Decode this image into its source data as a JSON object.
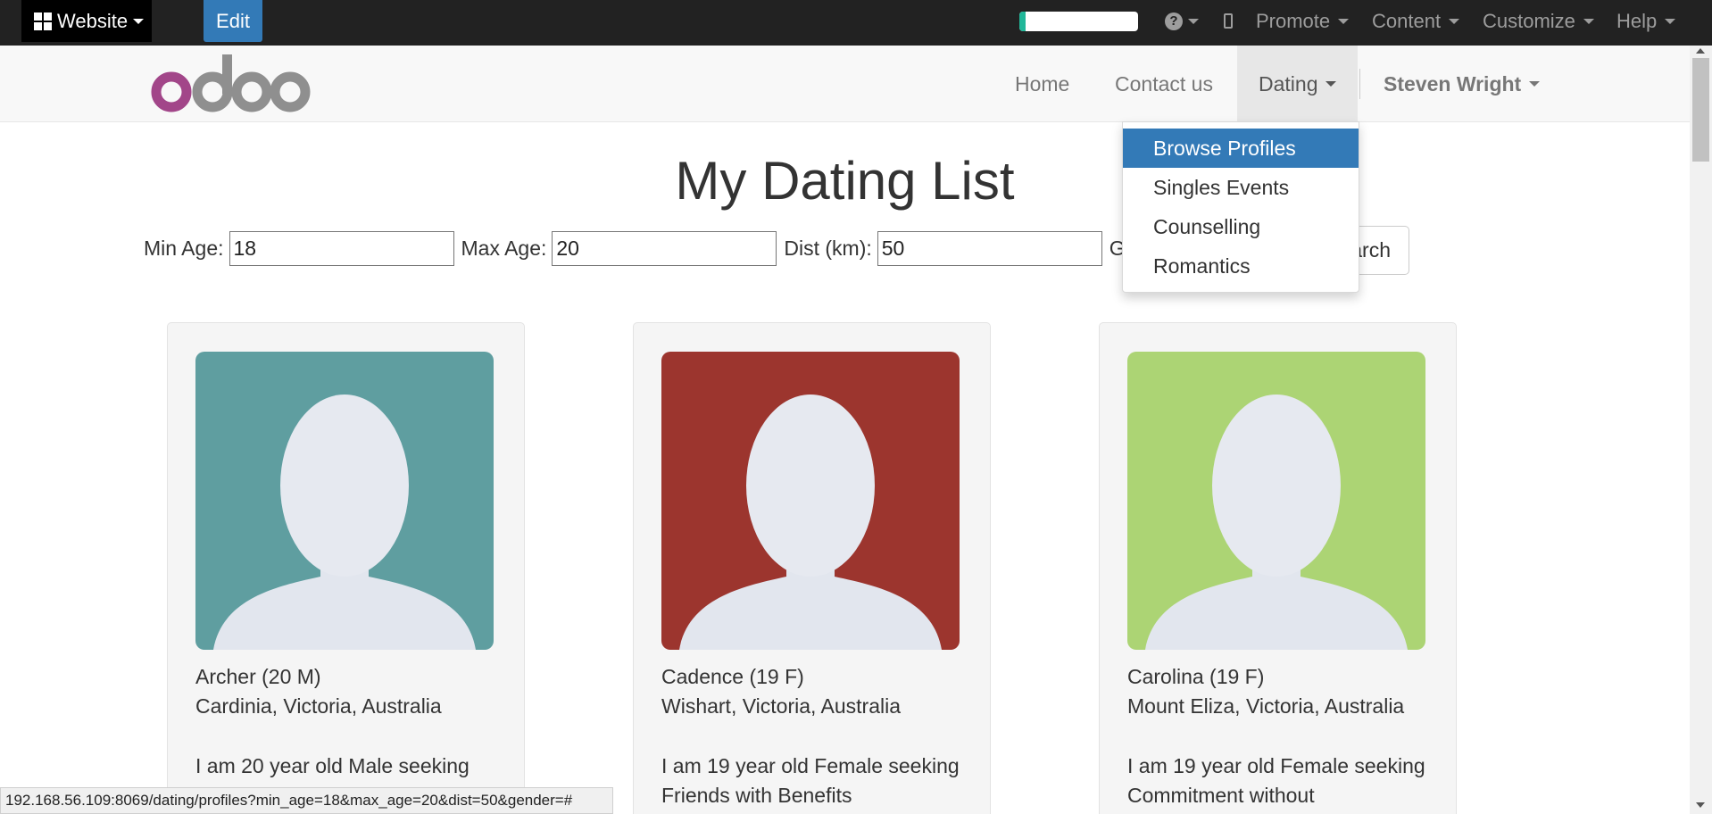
{
  "admin_bar": {
    "website_label": "Website",
    "edit_label": "Edit",
    "progress_fraction": 0.05,
    "promote_label": "Promote",
    "content_label": "Content",
    "customize_label": "Customize",
    "help_label": "Help"
  },
  "navbar": {
    "logo_text": "odoo",
    "home_label": "Home",
    "contact_label": "Contact us",
    "dating_label": "Dating",
    "user_label": "Steven Wright"
  },
  "dropdown": {
    "items": [
      {
        "label": "Browse Profiles",
        "active": true
      },
      {
        "label": "Singles Events",
        "active": false
      },
      {
        "label": "Counselling",
        "active": false
      },
      {
        "label": "Romantics",
        "active": false
      }
    ]
  },
  "main": {
    "title": "My Dating List",
    "filters": {
      "min_age_label": "Min Age:",
      "min_age_value": "18",
      "max_age_label": "Max Age:",
      "max_age_value": "20",
      "dist_label": "Dist (km):",
      "dist_value": "50",
      "gender_label_visible": "G"
    },
    "search_label_visible": "arch"
  },
  "profiles": [
    {
      "name": "Archer (20 M)",
      "location": "Cardinia, Victoria, Australia",
      "description": "I am 20 year old Male seeking",
      "avatar_bg": "#5f9ea0"
    },
    {
      "name": "Cadence (19 F)",
      "location": "Wishart, Victoria, Australia",
      "description": "I am 19 year old Female seeking Friends with Benefits",
      "avatar_bg": "#9c352e"
    },
    {
      "name": "Carolina (19 F)",
      "location": "Mount Eliza, Victoria, Australia",
      "description": "I am 19 year old Female seeking Commitment without",
      "avatar_bg": "#acd474"
    }
  ],
  "status_bar": {
    "url": "192.168.56.109:8069/dating/profiles?min_age=18&max_age=20&dist=50&gender=#"
  },
  "colors": {
    "admin_bg": "#222222",
    "accent_blue": "#337ab7",
    "progress_green": "#21b799",
    "logo_purple": "#a24689",
    "logo_gray": "#8f8f8f"
  }
}
